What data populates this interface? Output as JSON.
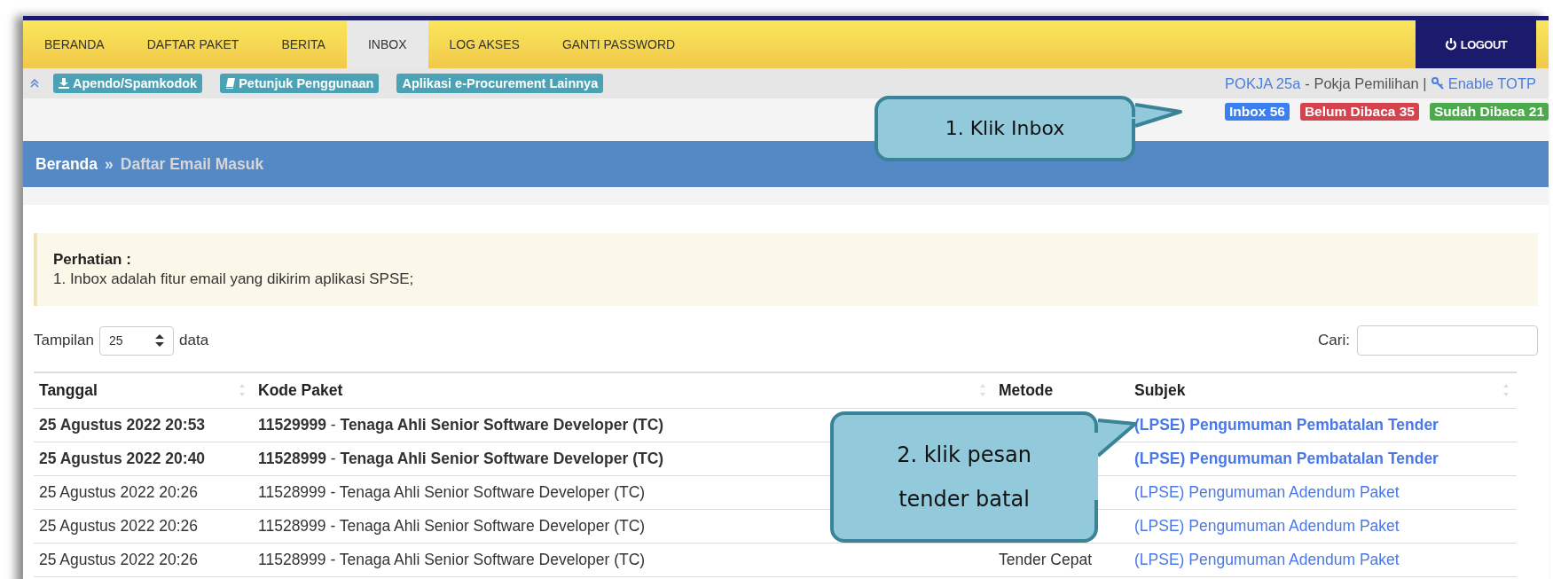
{
  "nav": {
    "items": [
      {
        "label": "BERANDA",
        "selected": false
      },
      {
        "label": "DAFTAR PAKET",
        "selected": false
      },
      {
        "label": "BERITA",
        "selected": false
      },
      {
        "label": "INBOX",
        "selected": true
      },
      {
        "label": "LOG AKSES",
        "selected": false
      },
      {
        "label": "GANTI PASSWORD",
        "selected": false
      }
    ],
    "logout": "LOGOUT"
  },
  "toolbar": {
    "links": [
      {
        "label": "Apendo/Spamkodok"
      },
      {
        "label": "Petunjuk Penggunaan"
      },
      {
        "label": "Aplikasi e-Procurement Lainnya"
      }
    ],
    "user": "POKJA 25a",
    "role": "- Pokja Pemilihan |",
    "totp": "Enable TOTP"
  },
  "badges": [
    {
      "label": "Inbox 56",
      "color": "#3b7ff0"
    },
    {
      "label": "Belum Dibaca 35",
      "color": "#d5434e"
    },
    {
      "label": "Sudah Dibaca 21",
      "color": "#4caa4c"
    }
  ],
  "breadcrumb": {
    "home": "Beranda",
    "separator": "»",
    "current": "Daftar Email Masuk"
  },
  "notice": {
    "title": "Perhatian :",
    "lines": [
      "1. Inbox adalah fitur email yang dikirim aplikasi SPSE;"
    ]
  },
  "length": {
    "label": "Tampilan",
    "value": "25",
    "suffix": "data"
  },
  "search": {
    "label": "Cari:"
  },
  "table": {
    "columns": [
      "Tanggal",
      "Kode Paket",
      "Metode",
      "Subjek"
    ],
    "rows": [
      {
        "unread": true,
        "tanggal": "25 Agustus 2022 20:53",
        "kode": "11529999",
        "dash": "-",
        "paket": "Tenaga Ahli Senior Software Developer (TC)",
        "subjek": "(LPSE) Pengumuman Pembatalan Tender"
      },
      {
        "unread": true,
        "tanggal": "25 Agustus 2022 20:40",
        "kode": "11528999",
        "dash": "-",
        "paket": "Tenaga Ahli Senior Software Developer (TC)",
        "subjek": "(LPSE) Pengumuman Pembatalan Tender"
      },
      {
        "unread": false,
        "tanggal": "25 Agustus 2022 20:26",
        "kode": "11528999",
        "dash": "-",
        "paket": "Tenaga Ahli Senior Software Developer (TC)",
        "subjek": "(LPSE) Pengumuman Adendum Paket"
      },
      {
        "unread": false,
        "tanggal": "25 Agustus 2022 20:26",
        "kode": "11528999",
        "dash": "-",
        "paket": "Tenaga Ahli Senior Software Developer (TC)",
        "subjek": "(LPSE) Pengumuman Adendum Paket"
      },
      {
        "unread": false,
        "tanggal": "25 Agustus 2022 20:26",
        "kode": "11528999",
        "dash": "-",
        "paket": "Tenaga Ahli Senior Software Developer (TC)",
        "metode": "Tender Cepat",
        "subjek": "(LPSE) Pengumuman Adendum Paket"
      }
    ]
  },
  "callouts": [
    {
      "lines": [
        "1. Klik Inbox"
      ]
    },
    {
      "lines": [
        "2. klik pesan",
        "tender batal"
      ]
    }
  ]
}
